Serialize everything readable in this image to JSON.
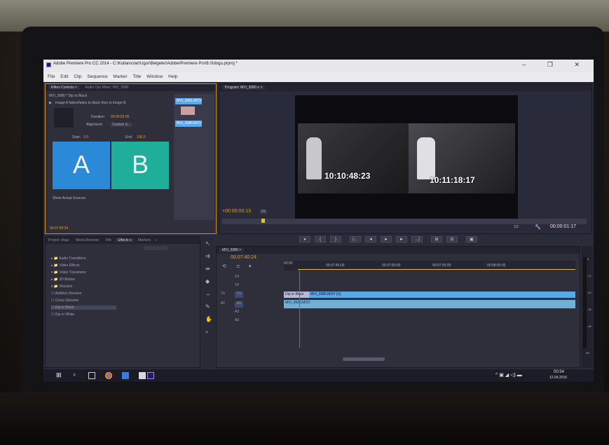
{
  "window": {
    "title": "Adobe Premiere Pro CC 2014 - C:\\Kullanıcılar\\Ugur\\Belgeler\\Adobe\\Premiere Pro\\8.0\\dogu.prproj *",
    "controls": "– ❐ ✕"
  },
  "menu": [
    "File",
    "Edit",
    "Clip",
    "Sequence",
    "Marker",
    "Title",
    "Window",
    "Help"
  ],
  "effect_controls": {
    "tab_active": "Effect Controls ×",
    "tab_other": "Audio Clip Mixer: MVI_3080",
    "clip_name": "MVI_3080 * Dip to Black",
    "description": "Image A fades/fades to black then to image B.",
    "duration_label": "Duration",
    "duration_value": "00:00:02:06",
    "alignment_label": "Alignment:",
    "alignment_value": "Custom S...",
    "start_label": "Start:",
    "start_value": "0.0",
    "end_label": "End:",
    "end_value": "100.0",
    "a_label": "A",
    "b_label": "B",
    "show_sources": "Show Actual Sources",
    "timecode": "00:07:40:24",
    "mini_clip_a": "MVI_3081.MOV",
    "mini_clip_b": "MVI_3080.MOV"
  },
  "program": {
    "tab": "Program: MVI_3080 ≡ ×",
    "overlay_left": "10:10:48:23",
    "overlay_right": "10:11:18:17",
    "current_timecode": "+00:00:00:13",
    "fit": "Fit",
    "zoom": "1/2",
    "duration": "00:00:01:17"
  },
  "transport": [
    "●",
    "{",
    "}",
    "{←",
    "◄",
    "►",
    "►",
    "→}",
    "⊞",
    "⊟",
    "▣"
  ],
  "project": {
    "tabs": [
      "Project: dogu",
      "Media Browser",
      "Info",
      "Effects ≡",
      "Markers",
      "»"
    ],
    "tree": [
      "▸ 📁 Audio Transitions",
      "▸ 📁 Video Effects",
      "▾ 📁 Video Transitions",
      "  ▸ 📁 3D Motion",
      "  ▾ 📁 Dissolve",
      "     ☐ Additive Dissolve",
      "     ☐ Cross Dissolve",
      "     ☐ Dip to Black",
      "     ☐ Dip to White"
    ]
  },
  "timeline": {
    "tab": "MVI_3080 ×",
    "timecode": "00:07:40:24",
    "ruler": [
      "00:00",
      "00:07:45:00",
      "00:07:50:00",
      "00:07:55:00",
      "00:08:00:00"
    ],
    "tracks": [
      "V3",
      "V2",
      "V1",
      "A1",
      "A2",
      "A3"
    ],
    "source_labels": [
      "V1",
      "A1"
    ],
    "clip_v1_a": "Dip to Black",
    "clip_v1_b": "MVI_3080.MOV [V]",
    "clip_a1": "MVI_3080.MOV"
  },
  "meter": {
    "scale": [
      "0",
      "-12",
      "-24",
      "-36",
      "-48",
      "dB"
    ]
  },
  "taskbar": {
    "time": "00:54",
    "date": "12.04.2016",
    "tray": "^ ▣ ◢ ◁) ▬"
  },
  "colors": {
    "accent_blue": "#5aa8e8",
    "accent_teal": "#1fae9a",
    "timecode_orange": "#e8a020",
    "audio_clip": "#6fb0d8"
  }
}
